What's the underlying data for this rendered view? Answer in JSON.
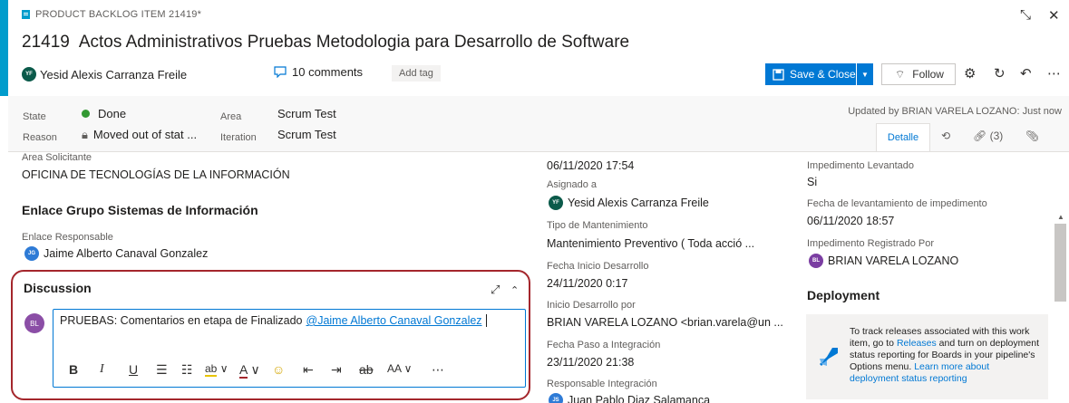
{
  "header": {
    "type_label": "PRODUCT BACKLOG ITEM 21419*",
    "id": "21419",
    "title": "Actos Administrativos Pruebas Metodologia para Desarrollo de Software",
    "assignee": "Yesid Alexis Carranza Freile",
    "assignee_initials": "YF",
    "comments": "10 comments",
    "add_tag": "Add tag",
    "save_close": "Save & Close",
    "follow": "Follow"
  },
  "state": {
    "state_label": "State",
    "state_value": "Done",
    "reason_label": "Reason",
    "reason_value": "Moved out of stat ...",
    "area_label": "Area",
    "area_value": "Scrum Test",
    "iteration_label": "Iteration",
    "iteration_value": "Scrum Test",
    "updated": "Updated by BRIAN VARELA LOZANO: Just now",
    "tab_detalle": "Detalle",
    "links_count": "(3)"
  },
  "left": {
    "area_solicitante_label": "Area Solicitante",
    "area_solicitante_value": "OFICINA DE TECNOLOGÍAS DE LA INFORMACIÓN",
    "section_title": "Enlace Grupo Sistemas de Información",
    "enlace_label": "Enlace Responsable",
    "enlace_value": "Jaime Alberto Canaval Gonzalez",
    "enlace_initials": "JG"
  },
  "discussion": {
    "title": "Discussion",
    "avatar_initials": "BL",
    "comment_text": "PRUEBAS: Comentarios en etapa de Finalizado",
    "mention": "@Jaime Alberto Canaval Gonzalez"
  },
  "middle": {
    "date_top": "06/11/2020 17:54",
    "asignado_label": "Asignado a",
    "asignado_value": "Yesid Alexis Carranza Freile",
    "asignado_initials": "YF",
    "tipo_label": "Tipo de Mantenimiento",
    "tipo_value": "Mantenimiento Preventivo ( Toda acció ...",
    "fecha_inicio_label": "Fecha Inicio Desarrollo",
    "fecha_inicio_value": "24/11/2020 0:17",
    "inicio_por_label": "Inicio Desarrollo por",
    "inicio_por_value": "BRIAN VARELA LOZANO <brian.varela@un ...",
    "fecha_paso_label": "Fecha Paso a Integración",
    "fecha_paso_value": "23/11/2020 21:38",
    "resp_label": "Responsable Integración",
    "resp_value": "Juan Pablo Diaz Salamanca",
    "resp_initials": "JS"
  },
  "right": {
    "imp_levantado_label": "Impedimento Levantado",
    "imp_levantado_value": "Si",
    "fecha_lev_label": "Fecha de levantamiento de impedimento",
    "fecha_lev_value": "06/11/2020 18:57",
    "imp_reg_label": "Impedimento Registrado Por",
    "imp_reg_value": "BRIAN VARELA LOZANO",
    "imp_reg_initials": "BL",
    "deployment_title": "Deployment",
    "deploy_t1": "To track releases associated with this work item, go to",
    "deploy_link1": "Releases",
    "deploy_t2": "and turn on deployment status reporting for Boards in your pipeline's Options menu.",
    "deploy_link2": "Learn more about deployment status reporting"
  },
  "colors": {
    "accent": "#009ccc",
    "primary": "#0078d4",
    "done": "#339933",
    "highlight": "#a4262c"
  }
}
